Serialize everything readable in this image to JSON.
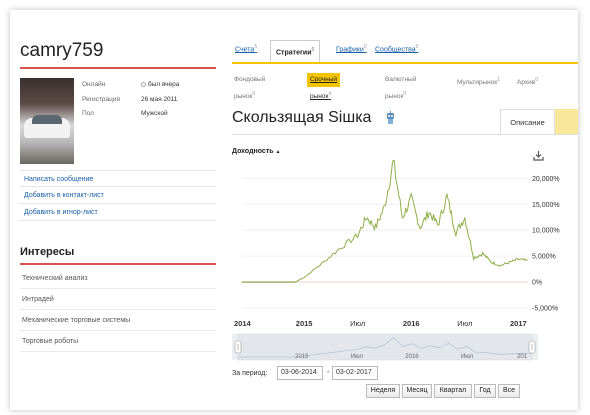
{
  "profile": {
    "username": "camry759",
    "fields": [
      {
        "label": "Онлайн",
        "value": "был вчера"
      },
      {
        "label": "Регистрация",
        "value": "26 мая 2011"
      },
      {
        "label": "Пол",
        "value": "Мужской"
      }
    ],
    "actions": [
      "Написать сообщение",
      "Добавить в контакт-лист",
      "Добавить в игнор-лист"
    ]
  },
  "interests": {
    "title": "Интересы",
    "items": [
      "Технический анализ",
      "Интрадей",
      "Механические торговые системы",
      "Торговые роботы"
    ]
  },
  "tabs": [
    {
      "label": "Счета",
      "count": "5"
    },
    {
      "label": "Стратегии",
      "count": "5"
    },
    {
      "label": "Графики",
      "count": "0"
    },
    {
      "label": "Сообщества",
      "count": "0"
    }
  ],
  "subtabs": [
    {
      "label": "Фондовый рынок",
      "count": "0"
    },
    {
      "label": "Срочный рынок",
      "count": "4"
    },
    {
      "label": "Валютный рынок",
      "count": "0"
    },
    {
      "label": "Мультирынок",
      "count": "1"
    },
    {
      "label": "Архив",
      "count": "0"
    }
  ],
  "strategy": {
    "title": "Скользящая Sішка",
    "description_tab": "Описание",
    "yield_label": "Доходность"
  },
  "colors": {
    "accent": "#f5c400",
    "line": "#8fae4a",
    "zero": "#c0392b",
    "divider": "#d9534f"
  },
  "icons": [
    "online-status-icon",
    "robot-icon",
    "sort-arrow-icon",
    "download-icon"
  ],
  "chart_data": {
    "type": "line",
    "ylabel": "",
    "y_ticks": [
      "20,000%",
      "15,000%",
      "10,000%",
      "5,000%",
      "0%",
      "-5,000%"
    ],
    "ylim": [
      -5000,
      22000
    ],
    "x_ticks": [
      "2014",
      "2015",
      "Июл",
      "2016",
      "Июл",
      "2017"
    ],
    "navigator_ticks": [
      "2015",
      "Июл",
      "2016",
      "Июл",
      "201"
    ],
    "series": [
      {
        "points": [
          [
            "2014-06",
            0
          ],
          [
            "2014-09",
            0
          ],
          [
            "2014-12",
            0
          ],
          [
            "2015-01",
            900
          ],
          [
            "2015-03",
            3600
          ],
          [
            "2015-05",
            6500
          ],
          [
            "2015-07",
            9000
          ],
          [
            "2015-08",
            12500
          ],
          [
            "2015-09",
            10500
          ],
          [
            "2015-10",
            14500
          ],
          [
            "2015-11",
            23300
          ],
          [
            "2015-12",
            12500
          ],
          [
            "2016-01",
            16000
          ],
          [
            "2016-02",
            10500
          ],
          [
            "2016-03",
            13500
          ],
          [
            "2016-04",
            11000
          ],
          [
            "2016-05",
            16500
          ],
          [
            "2016-06",
            9500
          ],
          [
            "2016-07",
            12500
          ],
          [
            "2016-08",
            4700
          ],
          [
            "2016-09",
            5500
          ],
          [
            "2016-10",
            3800
          ],
          [
            "2016-11",
            3200
          ],
          [
            "2016-12",
            3800
          ],
          [
            "2017-01",
            4400
          ],
          [
            "2017-02",
            4100
          ]
        ]
      }
    ]
  },
  "date_range": {
    "label": "За период:",
    "from": "03-06-2014",
    "to": "03-02-2017"
  },
  "periods": [
    "Неделя",
    "Месяц",
    "Квартал",
    "Год",
    "Все"
  ]
}
